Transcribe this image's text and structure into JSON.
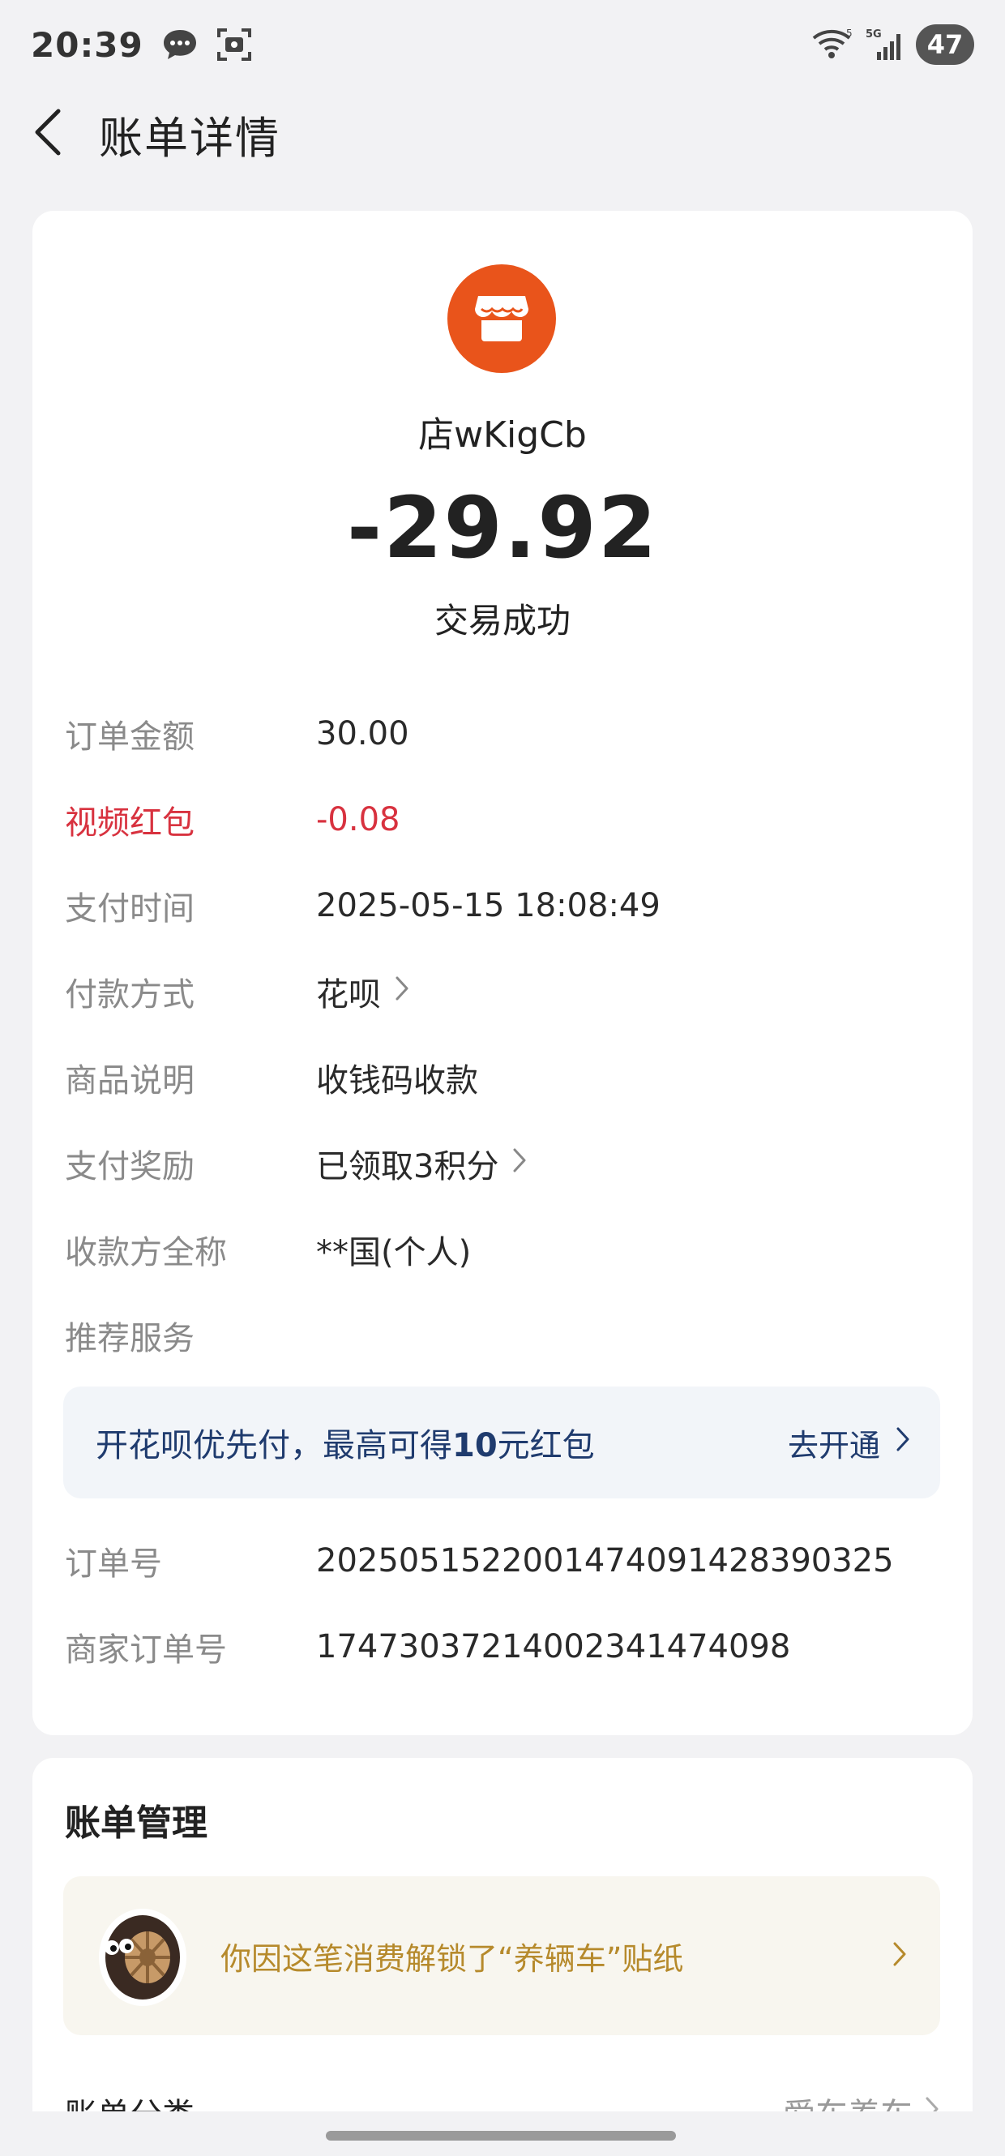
{
  "status_bar": {
    "time": "20:39",
    "signal_label": "5G",
    "wifi_label": "5",
    "battery": "47"
  },
  "nav": {
    "title": "账单详情"
  },
  "transaction": {
    "merchant_name": "店wKigCb",
    "amount": "-29.92",
    "status": "交易成功",
    "merchant_icon": "store-icon",
    "brand_color": "#e9541b"
  },
  "details": [
    {
      "label": "订单金额",
      "value": "30.00"
    },
    {
      "label": "视频红包",
      "value": "-0.08",
      "highlight_color": "#d8323f"
    },
    {
      "label": "支付时间",
      "value": "2025-05-15 18:08:49"
    },
    {
      "label": "付款方式",
      "value": "花呗"
    },
    {
      "label": "商品说明",
      "value": "收钱码收款"
    },
    {
      "label": "支付奖励",
      "value": "已领取3积分"
    },
    {
      "label": "收款方全称",
      "value": "**国(个人)"
    },
    {
      "label": "推荐服务",
      "value": ""
    },
    {
      "label": "订单号",
      "value": "2025051522001474091428390325"
    },
    {
      "label": "商家订单号",
      "value": "1747303721400234147409​8"
    }
  ],
  "promo": {
    "text_before": "开花呗优先付，最高可得",
    "text_bold": "10",
    "text_after": "元红包",
    "action": "去开通"
  },
  "manage": {
    "title": "账单管理",
    "sticker_text": "你因这笔消费解锁了“养辆车”贴纸",
    "category_label": "账单分类",
    "category_value": "爱车养车"
  }
}
